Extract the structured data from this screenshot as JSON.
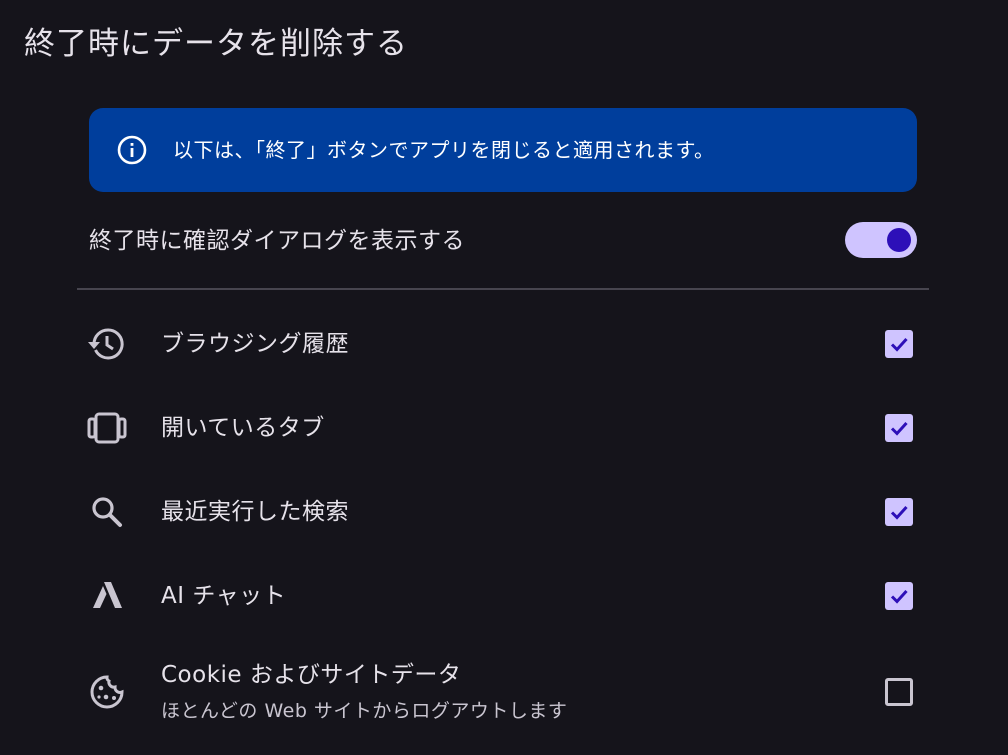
{
  "page": {
    "title": "終了時にデータを削除する"
  },
  "banner": {
    "icon": "info-icon",
    "text": "以下は、「終了」ボタンでアプリを閉じると適用されます。",
    "bg_color": "#003e9c"
  },
  "confirm_dialog": {
    "label": "終了時に確認ダイアログを表示する",
    "enabled": true
  },
  "options": [
    {
      "icon": "history-icon",
      "label": "ブラウジング履歴",
      "sublabel": "",
      "checked": true
    },
    {
      "icon": "tabs-icon",
      "label": "開いているタブ",
      "sublabel": "",
      "checked": true
    },
    {
      "icon": "search-icon",
      "label": "最近実行した検索",
      "sublabel": "",
      "checked": true
    },
    {
      "icon": "ai-chat-icon",
      "label": "AI チャット",
      "sublabel": "",
      "checked": true
    },
    {
      "icon": "cookie-icon",
      "label": "Cookie およびサイトデータ",
      "sublabel": "ほとんどの Web サイトからログアウトします",
      "checked": false
    }
  ],
  "colors": {
    "background": "#15141b",
    "accent": "#cfc4ff",
    "accent_dark": "#2d0fb8"
  }
}
